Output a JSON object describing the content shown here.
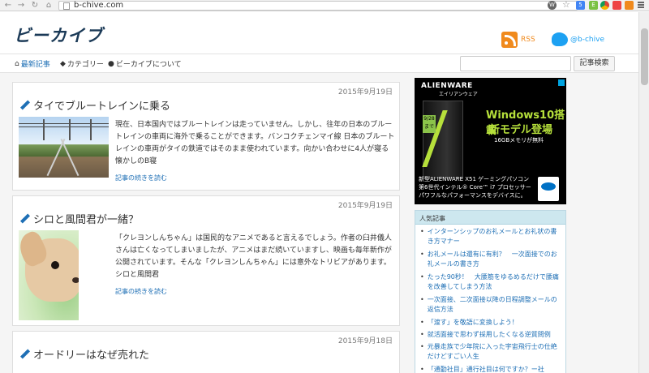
{
  "browser": {
    "url": "b-chive.com",
    "ext_icons": [
      "wordpress-icon",
      "translate-icon",
      "evernote-icon",
      "chrome-apps-icon",
      "bookmark-icon",
      "profile-icon"
    ]
  },
  "header": {
    "logo": "ビーカイブ",
    "rss_label": "RSS",
    "twitter_label": "@b-chive"
  },
  "nav": {
    "items": [
      {
        "label": "最新記事",
        "active": true
      },
      {
        "label": "カテゴリー",
        "active": false
      },
      {
        "label": "ビーカイブについて",
        "active": false
      }
    ],
    "search_placeholder": "",
    "search_button": "記事検索"
  },
  "articles": [
    {
      "date": "2015年9月19日",
      "title": "タイでブルートレインに乗る",
      "excerpt": "現在、日本国内ではブルートレインは走っていません。しかし、往年の日本のブルートレインの車両に海外で乗ることができます。バンコクチェンマイ線 日本のブルートレインの車両がタイの鉄道ではそのまま使われています。向かい合わせに4人が寝る懐かしのB寝",
      "more": "記事の続きを読む"
    },
    {
      "date": "2015年9月19日",
      "title": "シロと風間君が一緒？",
      "excerpt": "「クレヨンしんちゃん」は国民的なアニメであると言えるでしょう。作者の臼井儀人さんは亡くなってしまいましたが、アニメはまだ続いていますし、映画も毎年新作が公開されています。そんな「クレヨンしんちゃん」には意外なトリビアがあります。シロと風間君",
      "more": "記事の続きを読む"
    },
    {
      "date": "2015年9月18日",
      "title": "オードリーはなぜ売れた",
      "excerpt": "",
      "more": ""
    }
  ],
  "ad": {
    "brand": "ALIENWARE",
    "brand_sub": "エイリアンウェア",
    "badge": "9/28まで",
    "headline1": "Windows10搭載",
    "headline2": "新モデル登場",
    "sub": "16GBメモリが無料",
    "copy": "新型ALIENWARE X51 ゲーミングパソコン 第6世代インテル® Core™ i7 プロセッサー パワフルなパフォーマンスをデバイスに。"
  },
  "popular": {
    "heading": "人気記事",
    "items": [
      "インターンシップのお礼メールとお礼状の書き方マナー",
      "お礼メールは還有に有利？　一次面接でのお礼メールの書き方",
      "たった90秒！　大腰筋をゆるめるだけで腰痛を改善してしまう方法",
      "一次面接、二次面接以降の日程調整メールの返信方法",
      "「渡す」を敬語に変換しよう！",
      "就活面接で思わず採用したくなる逆質問例",
      "元暴走族で少年院に入った宇宙飛行士の仕絶だけどすごい人生",
      "「通勤社目」通行社目は何ですか？ー社"
    ]
  }
}
